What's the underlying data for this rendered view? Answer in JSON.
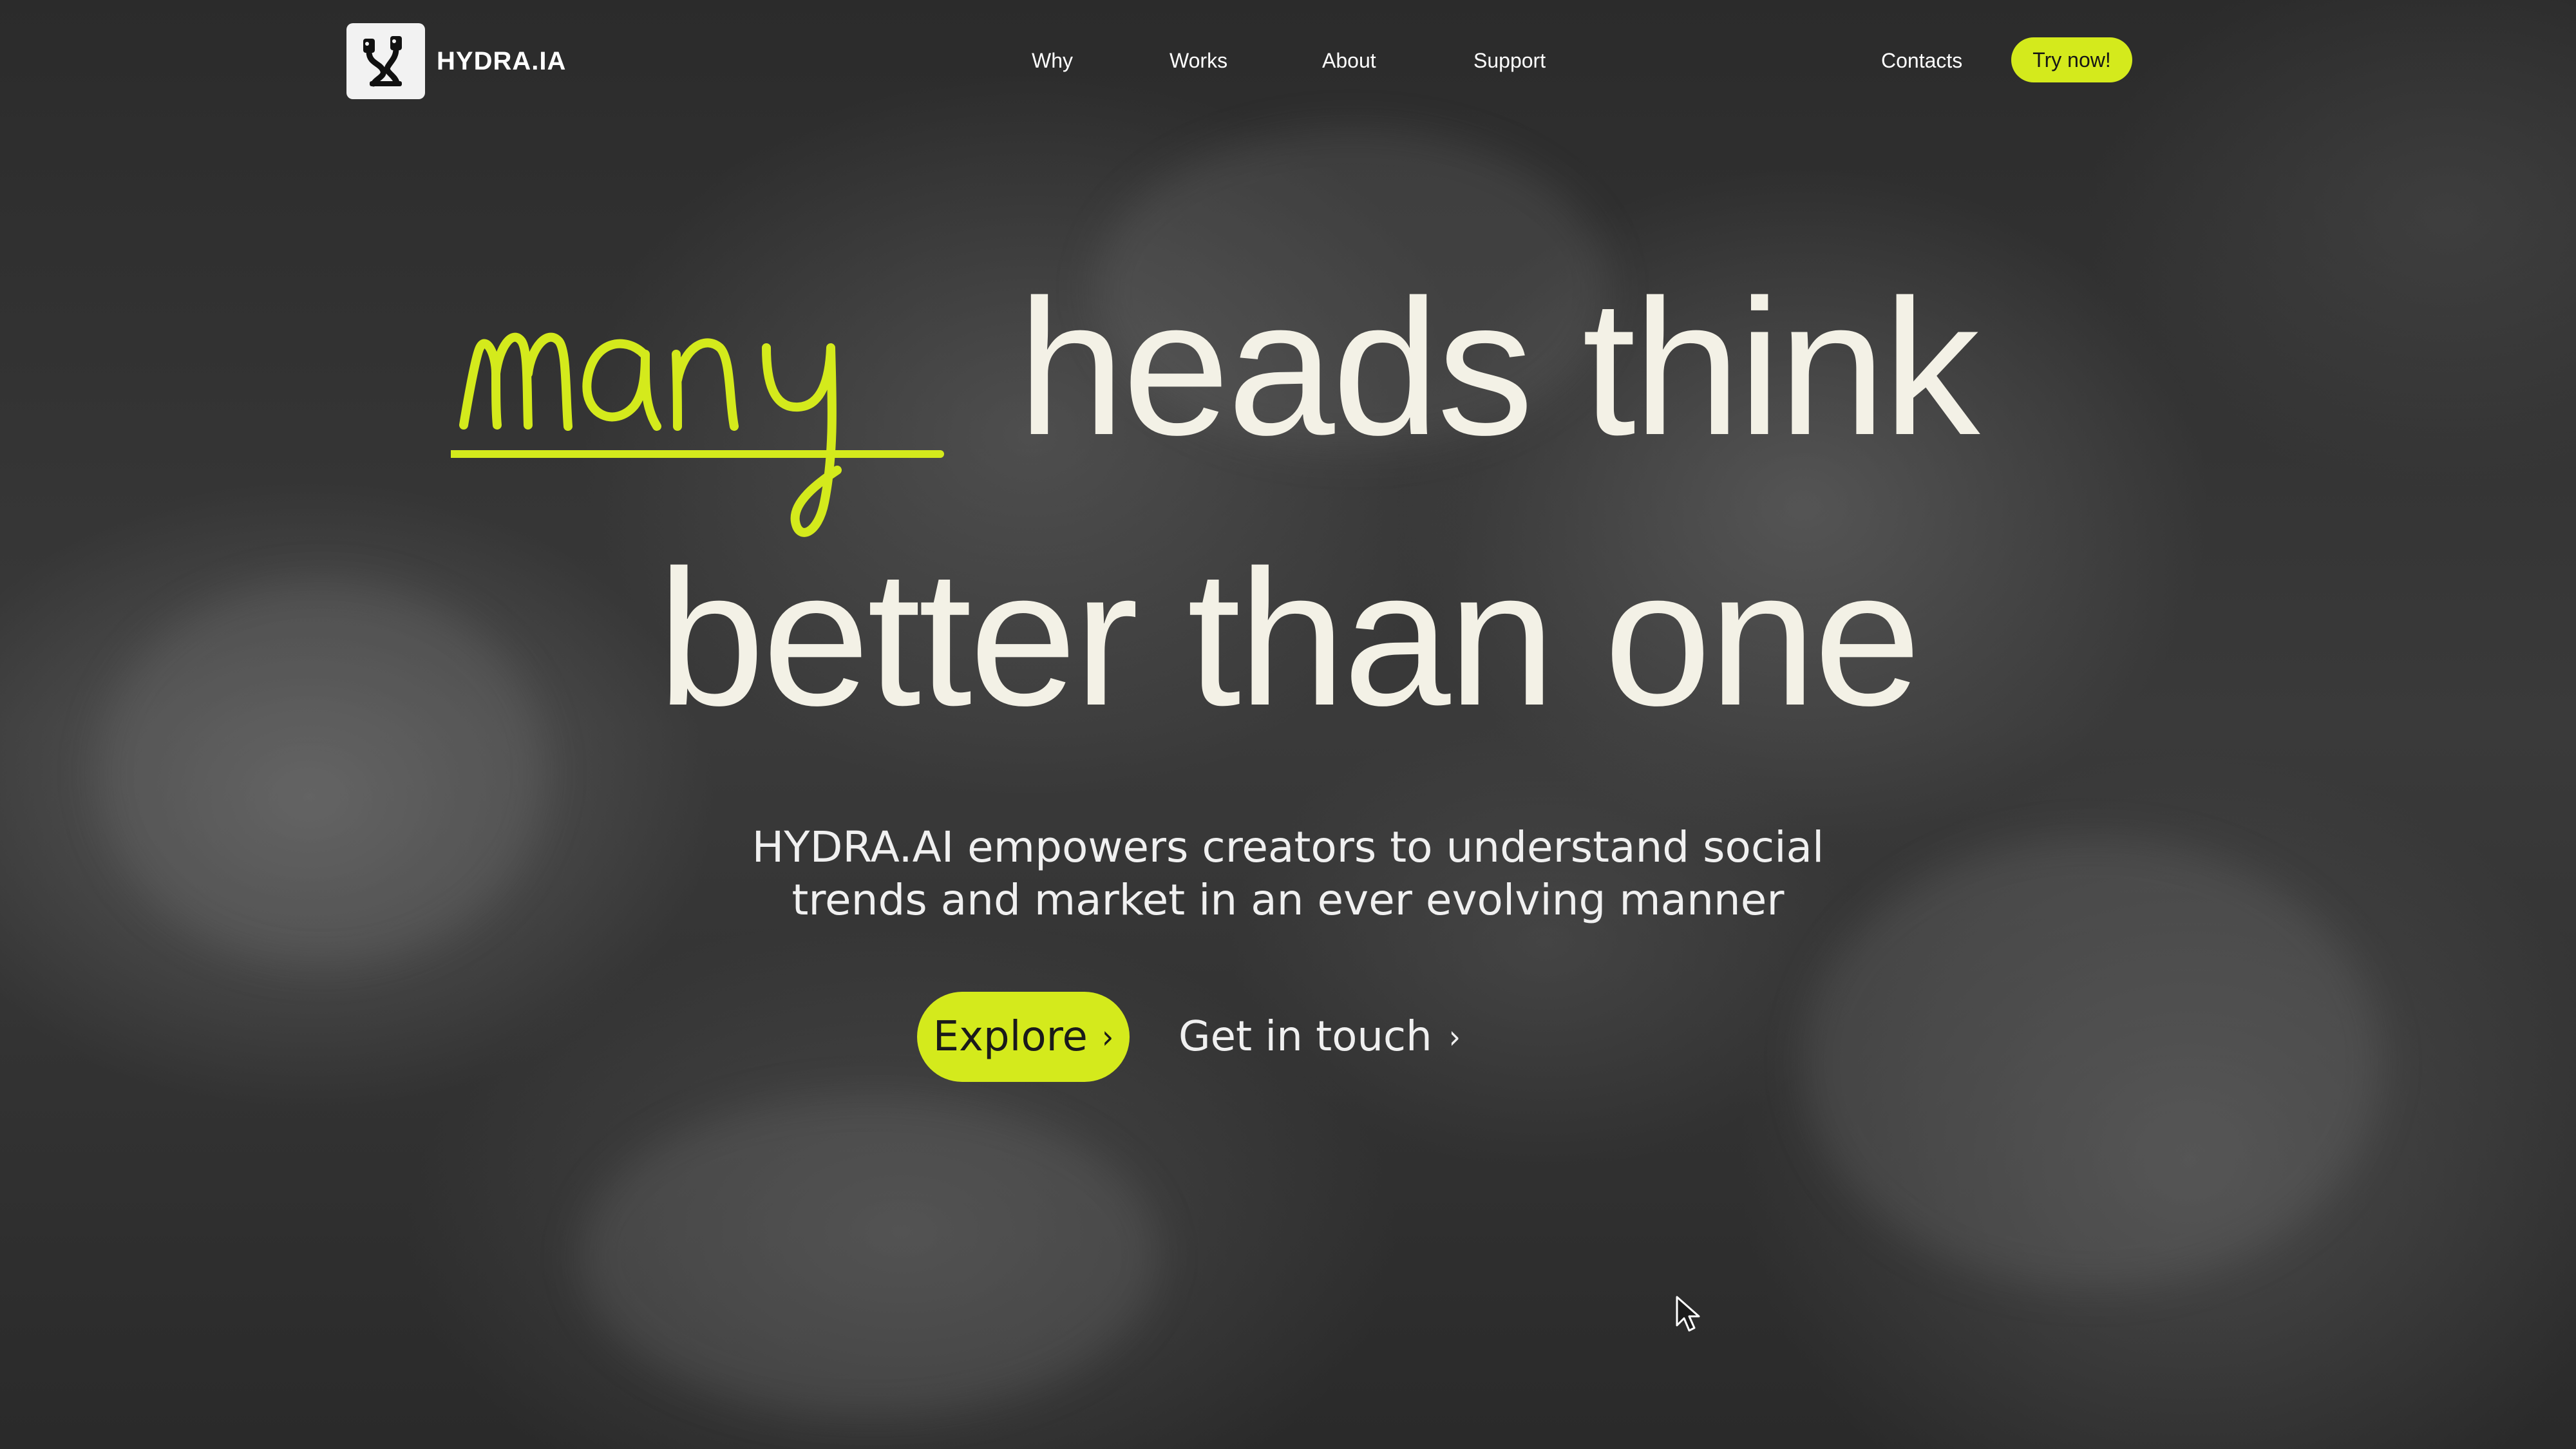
{
  "brand": {
    "name": "HYDRA.IA",
    "logo_icon": "hydra-logo-icon"
  },
  "nav": {
    "items": [
      {
        "label": "Why"
      },
      {
        "label": "Works"
      },
      {
        "label": "About"
      },
      {
        "label": "Support"
      }
    ],
    "contacts_label": "Contacts",
    "cta_label": "Try now!"
  },
  "hero": {
    "script_word": "many",
    "headline_line1": "heads think",
    "headline_line2": "better than one",
    "subtitle_line1": "HYDRA.AI empowers creators to understand social",
    "subtitle_line2": "trends and market in an ever evolving manner",
    "explore_label": "Explore",
    "touch_label": "Get in touch",
    "chevron_icon": "chevron-right-icon"
  },
  "colors": {
    "accent": "#d4ea1c",
    "headline": "#f3f1e6",
    "background": "#2e2e2e"
  }
}
